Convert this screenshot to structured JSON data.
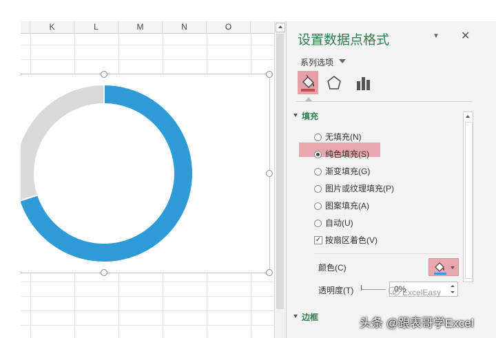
{
  "sheet": {
    "columns": [
      "K",
      "L",
      "M",
      "N",
      "O"
    ]
  },
  "chart": {
    "colors": {
      "filled": "#2e9bd6",
      "empty": "#d9d9d9"
    },
    "donut": {
      "filled_fraction": 0.7,
      "empty_fraction": 0.3
    }
  },
  "pane": {
    "title": "设置数据点格式",
    "series_options": "系列选项",
    "tabs": [
      "fill-line-icon",
      "effects-icon",
      "series-options-icon"
    ],
    "section_fill": "填充",
    "options": [
      {
        "label": "无填充(N)",
        "selected": false
      },
      {
        "label": "纯色填充(S)",
        "selected": true
      },
      {
        "label": "渐变填充(G)",
        "selected": false
      },
      {
        "label": "图片或纹理填充(P)",
        "selected": false
      },
      {
        "label": "图案填充(A)",
        "selected": false
      },
      {
        "label": "自动(U)",
        "selected": false
      }
    ],
    "vary_colors": {
      "label": "按扇区着色(V)",
      "checked": true
    },
    "color_label": "颜色(C)",
    "transparency_label": "透明度(T)",
    "transparency_value": "0%",
    "section_border": "边框",
    "accent": "#2e7d4f",
    "highlight": "#e8a6ae"
  },
  "watermark": {
    "small": "ExcelEasy",
    "main": "头条 @跟表哥学Excel"
  }
}
